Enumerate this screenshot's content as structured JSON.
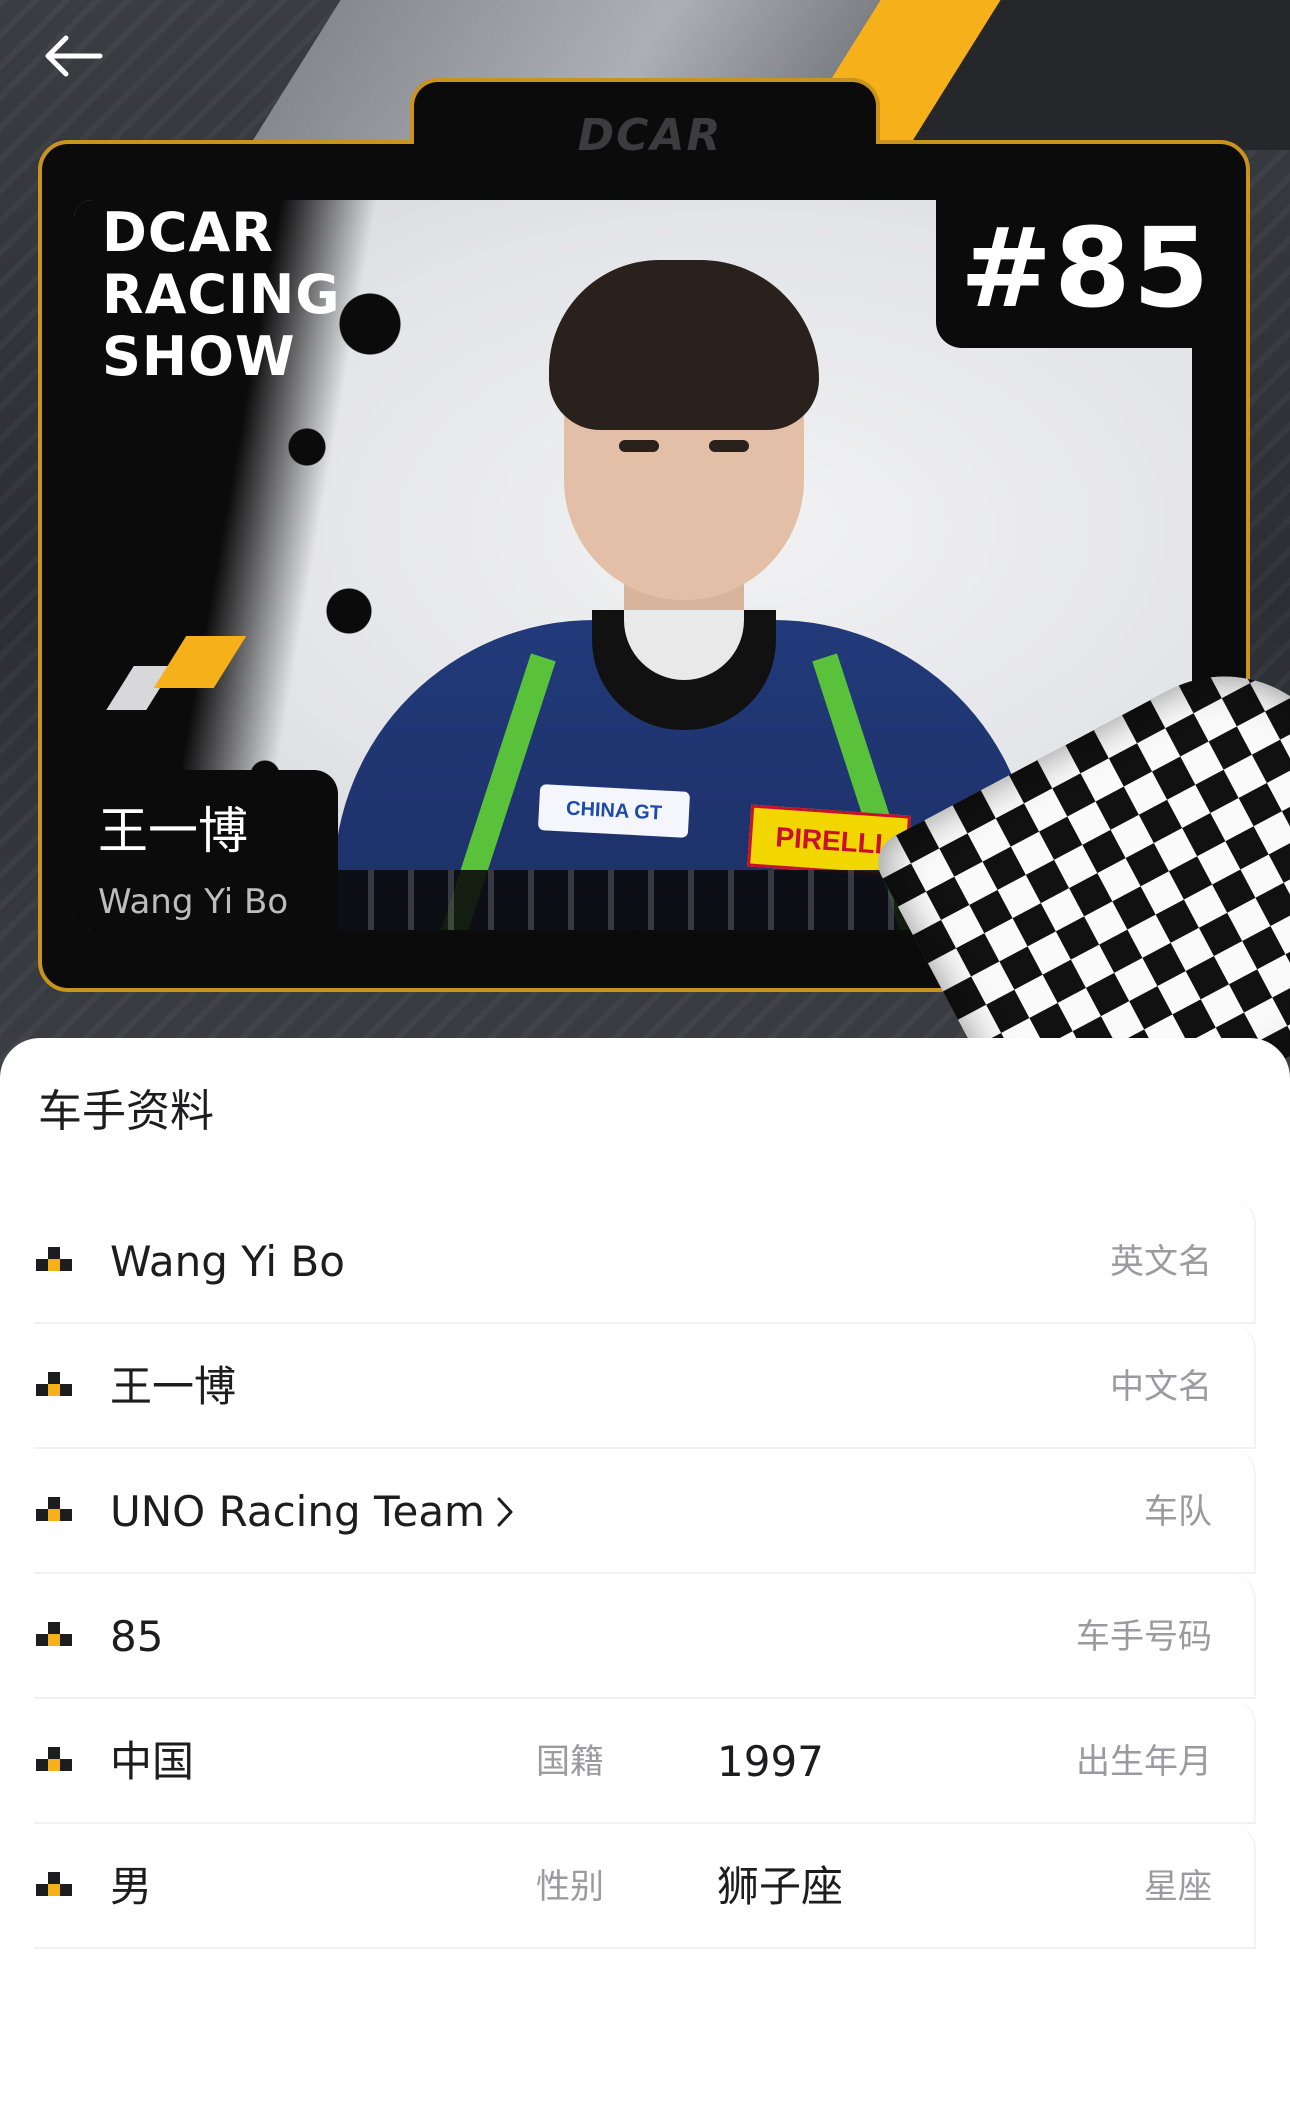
{
  "hero": {
    "brand_logo": "DCAR",
    "show_title_lines": [
      "DCAR",
      "RACING",
      "SHOW"
    ],
    "car_number": "#85",
    "driver_name_cn": "王一博",
    "driver_name_en": "Wang Yi Bo",
    "suit_badges": [
      "CHINA GT",
      "PIRELLI"
    ],
    "colors": {
      "accent_yellow": "#f5b01a",
      "frame_gold": "#c8941c"
    }
  },
  "profile": {
    "section_title": "车手资料",
    "rows": [
      {
        "value": "Wang Yi Bo",
        "label": "英文名"
      },
      {
        "value": "王一博",
        "label": "中文名"
      },
      {
        "value": "UNO Racing Team",
        "label": "车队",
        "link": true
      },
      {
        "value": "85",
        "label": "车手号码"
      }
    ],
    "pair_rows": [
      {
        "left": {
          "value": "中国",
          "label": "国籍"
        },
        "right": {
          "value": "1997",
          "label": "出生年月"
        }
      },
      {
        "left": {
          "value": "男",
          "label": "性别"
        },
        "right": {
          "value": "狮子座",
          "label": "星座"
        }
      }
    ],
    "row_icon": "checkered-flag-icon"
  }
}
